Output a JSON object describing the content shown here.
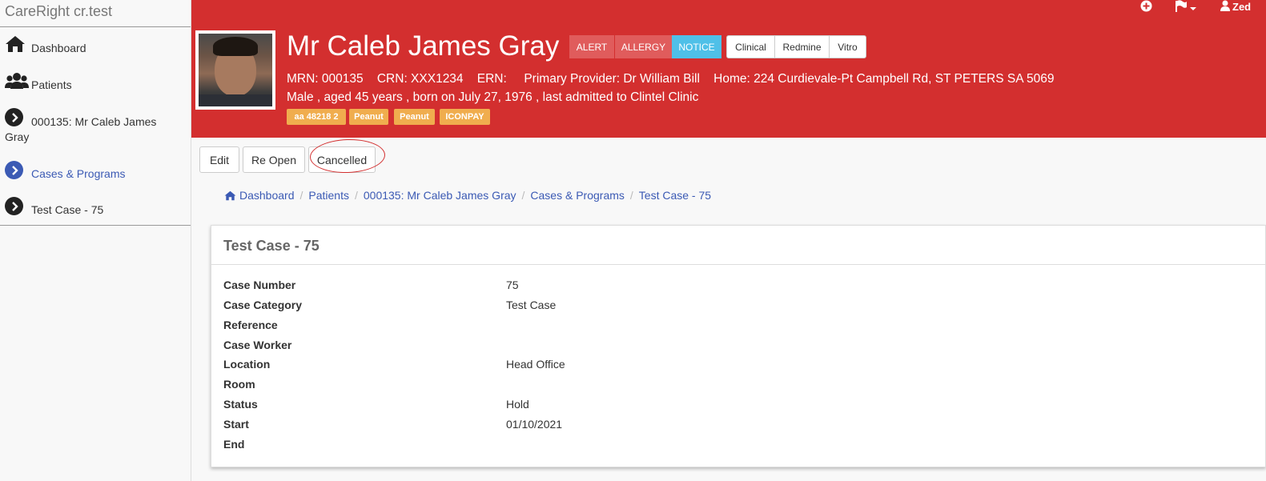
{
  "brand": "CareRight cr.test",
  "sidebar": {
    "items": [
      {
        "label": "Dashboard"
      },
      {
        "label": "Patients"
      },
      {
        "label": "000135: Mr Caleb James",
        "label2": "Gray"
      },
      {
        "label": "Cases & Programs"
      },
      {
        "label": "Test Case - 75"
      }
    ]
  },
  "topbar": {
    "user": "Zed"
  },
  "patient": {
    "name": "Mr Caleb James Gray",
    "buttons": [
      "ALERT",
      "ALLERGY",
      "NOTICE",
      "Clinical",
      "Redmine",
      "Vitro"
    ],
    "detail_line1": "MRN: 000135    CRN: XXX1234    ERN:     Primary Provider: Dr William Bill    Home: 224 Curdievale-Pt Campbell Rd, ST PETERS SA 5069",
    "detail_line2": "Male , aged 45 years , born on July 27, 1976 , last admitted to Clintel Clinic",
    "tags": [
      "aa 48218 2",
      "Peanut",
      "Peanut",
      "ICONPAY"
    ]
  },
  "actions": {
    "edit": "Edit",
    "reopen": "Re Open",
    "cancelled": "Cancelled"
  },
  "breadcrumb": [
    "Dashboard",
    "Patients",
    "000135: Mr Caleb James Gray",
    "Cases & Programs",
    "Test Case - 75"
  ],
  "case": {
    "title": "Test Case - 75",
    "fields": [
      {
        "label": "Case Number",
        "value": "75"
      },
      {
        "label": "Case Category",
        "value": "Test Case"
      },
      {
        "label": "Reference",
        "value": ""
      },
      {
        "label": "Case Worker",
        "value": ""
      },
      {
        "label": "Location",
        "value": "Head Office"
      },
      {
        "label": "Room",
        "value": ""
      },
      {
        "label": "Status",
        "value": "Hold"
      },
      {
        "label": "Start",
        "value": "01/10/2021"
      },
      {
        "label": "End",
        "value": ""
      }
    ]
  },
  "colors": {
    "header_red": "#d32f2f",
    "link_blue": "#3b5ab4",
    "tag_orange": "#f0ad4e",
    "notice_blue": "#4fc0e8"
  }
}
